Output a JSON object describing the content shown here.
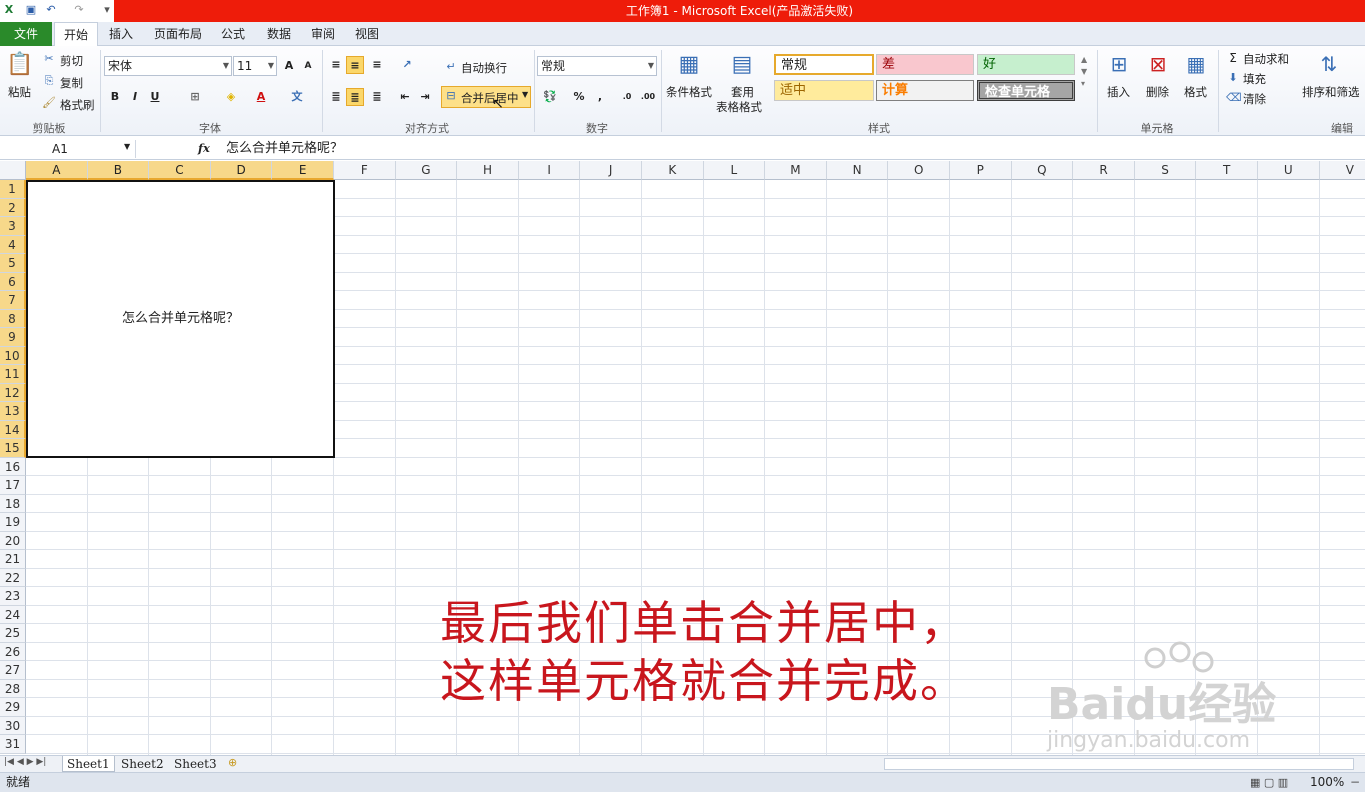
{
  "window": {
    "title": "工作簿1 - Microsoft Excel(产品激活失败)"
  },
  "tabs": [
    "文件",
    "开始",
    "插入",
    "页面布局",
    "公式",
    "数据",
    "审阅",
    "视图"
  ],
  "ribbon": {
    "clipboard": {
      "paste": "粘贴",
      "cut": "剪切",
      "copy": "复制",
      "format_painter": "格式刷",
      "label": "剪贴板"
    },
    "font": {
      "name": "宋体",
      "size": "11",
      "label": "字体",
      "bold": "B",
      "italic": "I",
      "underline": "U"
    },
    "alignment": {
      "wrap": "自动换行",
      "merge": "合并后居中",
      "label": "对齐方式"
    },
    "number": {
      "format": "常规",
      "label": "数字",
      "percent": "%",
      "comma": ","
    },
    "styles": {
      "conditional": "条件格式",
      "table_format_1": "套用",
      "table_format_2": "表格格式",
      "cells": [
        "常规",
        "差",
        "好",
        "适中",
        "计算",
        "检查单元格"
      ],
      "label": "样式"
    },
    "cells": {
      "insert": "插入",
      "delete": "删除",
      "format": "格式",
      "label": "单元格"
    },
    "editing": {
      "autosum": "自动求和",
      "fill": "填充",
      "clear": "清除",
      "sort": "排序和筛选",
      "label": "编辑"
    }
  },
  "formula_bar": {
    "name_box": "A1",
    "fx": "fx",
    "content": "怎么合并单元格呢？"
  },
  "grid": {
    "columns": [
      "A",
      "B",
      "C",
      "D",
      "E",
      "F",
      "G",
      "H",
      "I",
      "J",
      "K",
      "L",
      "M",
      "N",
      "O",
      "P",
      "Q",
      "R",
      "S",
      "T",
      "U",
      "V"
    ],
    "rows": [
      "1",
      "2",
      "3",
      "4",
      "5",
      "6",
      "7",
      "8",
      "9",
      "10",
      "11",
      "12",
      "13",
      "14",
      "15",
      "16",
      "17",
      "18",
      "19",
      "20",
      "21",
      "22",
      "23",
      "24",
      "25",
      "26",
      "27",
      "28",
      "29",
      "30",
      "31"
    ],
    "merged_cell_text": "怎么合并单元格呢？"
  },
  "caption": {
    "line1": "最后我们单击合并居中，",
    "line2": "这样单元格就合并完成。"
  },
  "watermark": {
    "brand": "Baidu经验",
    "url": "jingyan.baidu.com"
  },
  "sheets": [
    "Sheet1",
    "Sheet2",
    "Sheet3"
  ],
  "status": {
    "ready": "就绪",
    "zoom": "100%"
  },
  "colors": {
    "title_bar": "#ee1c0a",
    "file_tab": "#2a8a2a",
    "selection": "#f7d88a",
    "caption": "#c8161d"
  }
}
